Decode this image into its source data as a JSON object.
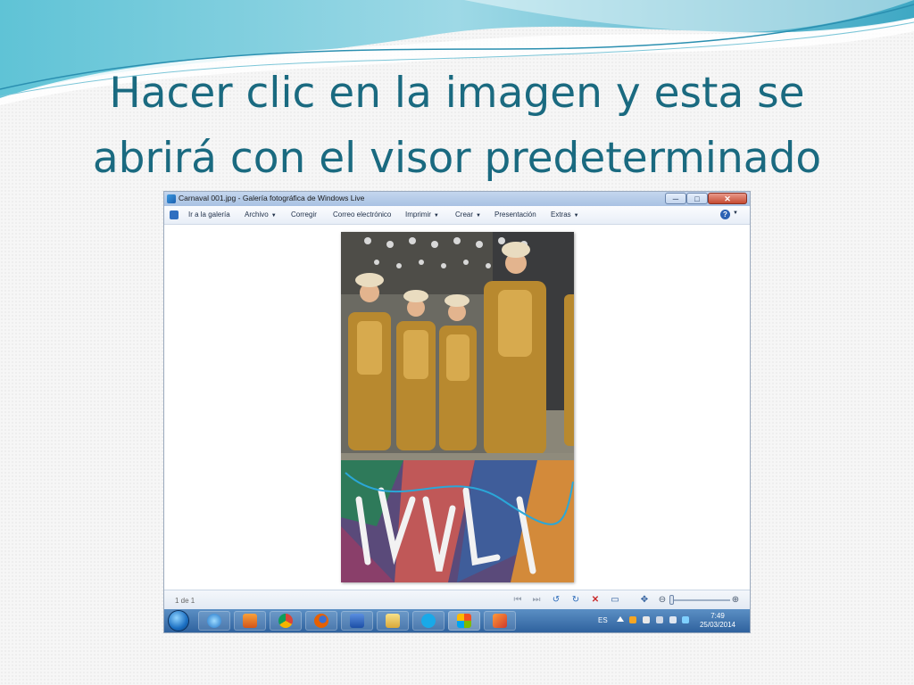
{
  "slide": {
    "title_line1": "Hacer clic en la imagen y esta se",
    "title_line2": "abrirá con el visor predeterminado",
    "accent": "#1a6a80"
  },
  "window": {
    "title": "Carnaval 001.jpg - Galería fotográfica de Windows Live",
    "buttons": {
      "minimize": "─",
      "maximize": "□",
      "close": "✕"
    }
  },
  "menu": {
    "back_label": "Ir a la galería",
    "items": [
      "Archivo",
      "Corregir",
      "Correo electrónico",
      "Imprimir",
      "Crear",
      "Presentación",
      "Extras"
    ],
    "help": "?"
  },
  "controls": {
    "page_count": "1 de 1",
    "icons": [
      "previous-icon",
      "next-icon",
      "rotate-left-icon",
      "rotate-right-icon",
      "delete-icon",
      "slideshow-icon",
      "fit-icon",
      "zoom-out-icon",
      "zoom-in-icon"
    ]
  },
  "taskbar": {
    "apps": [
      "internet-explorer",
      "media-player",
      "chrome",
      "firefox",
      "word",
      "file-explorer",
      "skype",
      "windows-live",
      "photo-gallery"
    ],
    "language": "ES",
    "time": "7:49",
    "date": "25/03/2014"
  }
}
